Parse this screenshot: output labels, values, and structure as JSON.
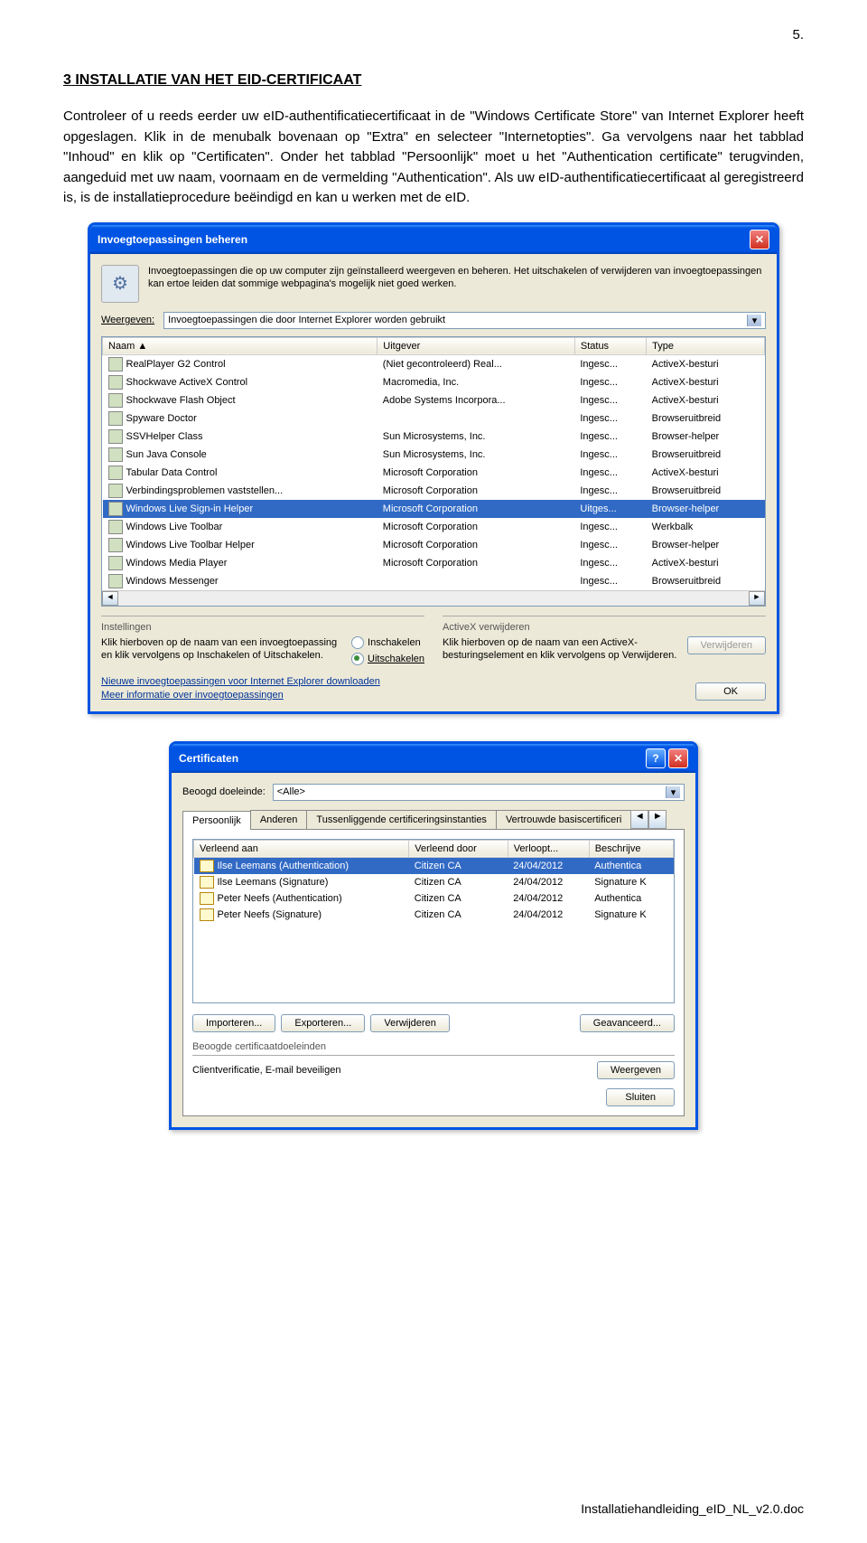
{
  "page_number": "5.",
  "section": {
    "number": "3",
    "title": "INSTALLATIE VAN HET EID-CERTIFICAAT"
  },
  "paragraph": "Controleer of u reeds eerder uw eID-authentificatiecertificaat in de \"Windows Certificate Store\" van Internet Explorer heeft opgeslagen. Klik in de menubalk bovenaan op \"Extra\" en selecteer \"Internetopties\". Ga vervolgens naar het tabblad \"Inhoud\" en klik op \"Certificaten\". Onder het tabblad \"Persoonlijk\" moet u het \"Authentication certificate\" terugvinden, aangeduid met uw naam, voornaam en de vermelding \"Authentication\". Als uw eID-authentificatiecertificaat al geregistreerd is, is de installatieprocedure beëindigd en kan u werken met de eID.",
  "dialog1": {
    "title": "Invoegtoepassingen beheren",
    "info": "Invoegtoepassingen die op uw computer zijn geïnstalleerd weergeven en beheren. Het uitschakelen of verwijderen van invoegtoepassingen kan ertoe leiden dat sommige webpagina's mogelijk niet goed werken.",
    "show_label": "Weergeven:",
    "show_value": "Invoegtoepassingen die door Internet Explorer worden gebruikt",
    "columns": [
      "Naam",
      "Uitgever",
      "Status",
      "Type"
    ],
    "rows": [
      {
        "name": "RealPlayer G2 Control",
        "pub": "(Niet gecontroleerd) Real...",
        "status": "Ingesc...",
        "type": "ActiveX-besturi"
      },
      {
        "name": "Shockwave ActiveX Control",
        "pub": "Macromedia, Inc.",
        "status": "Ingesc...",
        "type": "ActiveX-besturi"
      },
      {
        "name": "Shockwave Flash Object",
        "pub": "Adobe Systems Incorpora...",
        "status": "Ingesc...",
        "type": "ActiveX-besturi"
      },
      {
        "name": "Spyware Doctor",
        "pub": "",
        "status": "Ingesc...",
        "type": "Browseruitbreid"
      },
      {
        "name": "SSVHelper Class",
        "pub": "Sun Microsystems, Inc.",
        "status": "Ingesc...",
        "type": "Browser-helper"
      },
      {
        "name": "Sun Java Console",
        "pub": "Sun Microsystems, Inc.",
        "status": "Ingesc...",
        "type": "Browseruitbreid"
      },
      {
        "name": "Tabular Data Control",
        "pub": "Microsoft Corporation",
        "status": "Ingesc...",
        "type": "ActiveX-besturi"
      },
      {
        "name": "Verbindingsproblemen vaststellen...",
        "pub": "Microsoft Corporation",
        "status": "Ingesc...",
        "type": "Browseruitbreid"
      },
      {
        "name": "Windows Live Sign-in Helper",
        "pub": "Microsoft Corporation",
        "status": "Uitges...",
        "type": "Browser-helper",
        "selected": true
      },
      {
        "name": "Windows Live Toolbar",
        "pub": "Microsoft Corporation",
        "status": "Ingesc...",
        "type": "Werkbalk"
      },
      {
        "name": "Windows Live Toolbar Helper",
        "pub": "Microsoft Corporation",
        "status": "Ingesc...",
        "type": "Browser-helper"
      },
      {
        "name": "Windows Media Player",
        "pub": "Microsoft Corporation",
        "status": "Ingesc...",
        "type": "ActiveX-besturi"
      },
      {
        "name": "Windows Messenger",
        "pub": "",
        "status": "Ingesc...",
        "type": "Browseruitbreid"
      }
    ],
    "settings": {
      "label": "Instellingen",
      "text": "Klik hierboven op de naam van een invoegtoepassing en klik vervolgens op Inschakelen of Uitschakelen.",
      "radio_enable": "Inschakelen",
      "radio_disable": "Uitschakelen"
    },
    "remove": {
      "label": "ActiveX verwijderen",
      "text": "Klik hierboven op de naam van een ActiveX-besturingselement en klik vervolgens op Verwijderen.",
      "button": "Verwijderen"
    },
    "link1": "Nieuwe invoegtoepassingen voor Internet Explorer downloaden",
    "link2": "Meer informatie over invoegtoepassingen",
    "ok": "OK"
  },
  "dialog2": {
    "title": "Certificaten",
    "purpose_label": "Beoogd doeleinde:",
    "purpose_value": "<Alle>",
    "tabs": [
      "Persoonlijk",
      "Anderen",
      "Tussenliggende certificeringsinstanties",
      "Vertrouwde basiscertificeri"
    ],
    "columns": [
      "Verleend aan",
      "Verleend door",
      "Verloopt...",
      "Beschrijve"
    ],
    "rows": [
      {
        "to": "Ilse Leemans (Authentication)",
        "by": "Citizen CA",
        "exp": "24/04/2012",
        "desc": "Authentica",
        "selected": true
      },
      {
        "to": "Ilse Leemans (Signature)",
        "by": "Citizen CA",
        "exp": "24/04/2012",
        "desc": "Signature K"
      },
      {
        "to": "Peter Neefs (Authentication)",
        "by": "Citizen CA",
        "exp": "24/04/2012",
        "desc": "Authentica"
      },
      {
        "to": "Peter Neefs (Signature)",
        "by": "Citizen CA",
        "exp": "24/04/2012",
        "desc": "Signature K"
      }
    ],
    "buttons": {
      "import": "Importeren...",
      "export": "Exporteren...",
      "remove": "Verwijderen",
      "advanced": "Geavanceerd..."
    },
    "cert_purposes_label": "Beoogde certificaatdoeleinden",
    "cert_purposes_text": "Clientverificatie, E-mail beveiligen",
    "view": "Weergeven",
    "close": "Sluiten"
  },
  "footer": "Installatiehandleiding_eID_NL_v2.0.doc"
}
